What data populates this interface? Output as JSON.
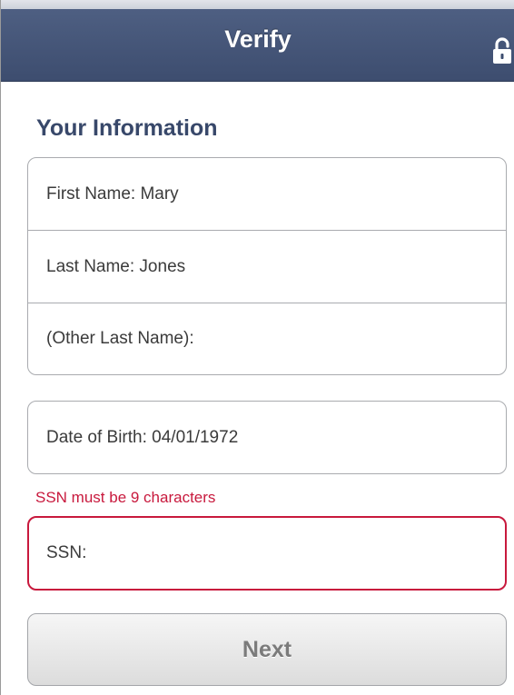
{
  "header": {
    "title": "Verify",
    "icon": "lock-icon"
  },
  "section": {
    "title": "Your Information"
  },
  "fields": {
    "first_name": "First Name: Mary",
    "last_name": "Last Name: Jones",
    "other_last_name": "(Other Last Name):",
    "dob": "Date of Birth: 04/01/1972",
    "ssn": "SSN:"
  },
  "validation": {
    "ssn_error": "SSN must be 9 characters"
  },
  "actions": {
    "next_label": "Next"
  },
  "colors": {
    "header_bg": "#44557a",
    "section_title": "#38486a",
    "error": "#c8193d",
    "button_text": "#7b7b7b"
  }
}
